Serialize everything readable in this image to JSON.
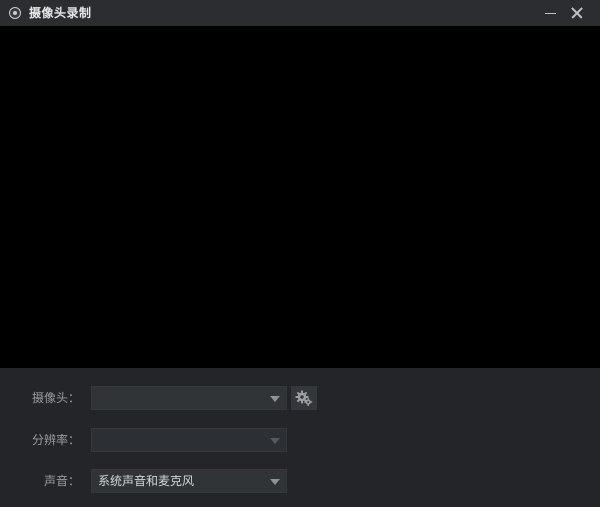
{
  "window": {
    "title": "摄像头录制"
  },
  "settings": {
    "camera": {
      "label": "摄像头：",
      "value": ""
    },
    "resolution": {
      "label": "分辨率：",
      "value": ""
    },
    "audio": {
      "label": "声音：",
      "value": "系统声音和麦克风"
    }
  },
  "icons": {
    "app": "webcam-icon",
    "minimize": "minimize-icon",
    "close": "close-icon",
    "dropdown": "chevron-down-icon",
    "settings": "gears-icon"
  }
}
